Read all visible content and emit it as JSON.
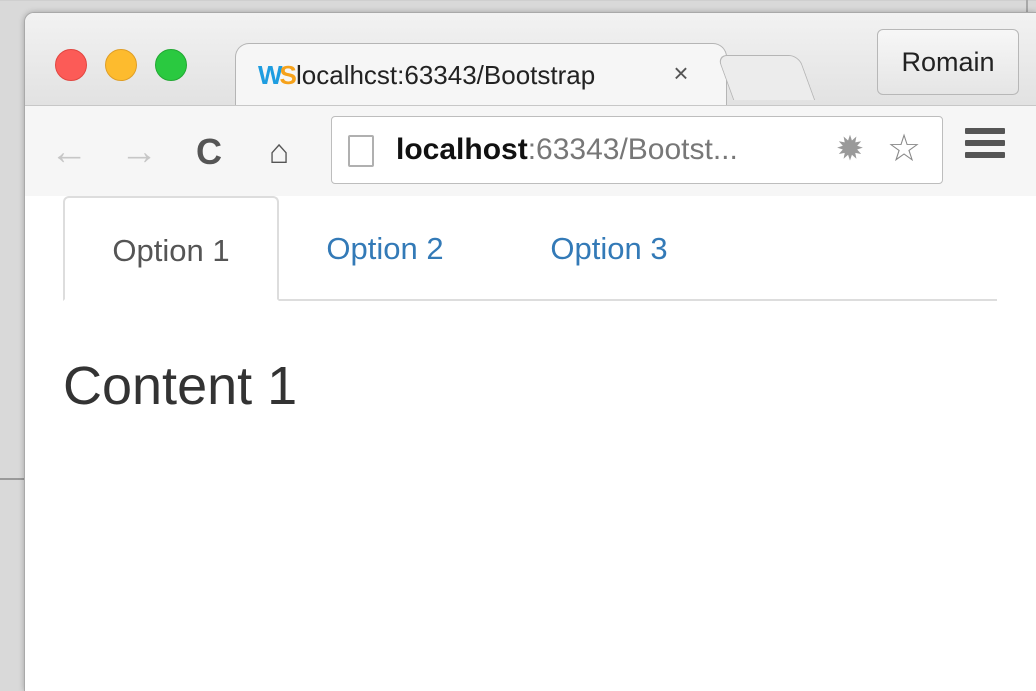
{
  "browser": {
    "tab_title": "localhcst:63343/Bootstrap",
    "tab_close": "×",
    "favicon_w": "W",
    "favicon_s": "S",
    "profile_name": "Romain",
    "url_host": "localhost",
    "url_rest": ":63343/Bootst...",
    "icons": {
      "back": "←",
      "forward": "→",
      "reload": "C",
      "home": "⌂",
      "extension": "✹",
      "star": "☆"
    }
  },
  "page": {
    "tabs": [
      {
        "label": "Option 1"
      },
      {
        "label": "Option 2"
      },
      {
        "label": "Option 3"
      }
    ],
    "heading": "Content 1"
  },
  "colors": {
    "link": "#337ab7",
    "active_tab_text": "#555555",
    "heading": "#333333"
  }
}
